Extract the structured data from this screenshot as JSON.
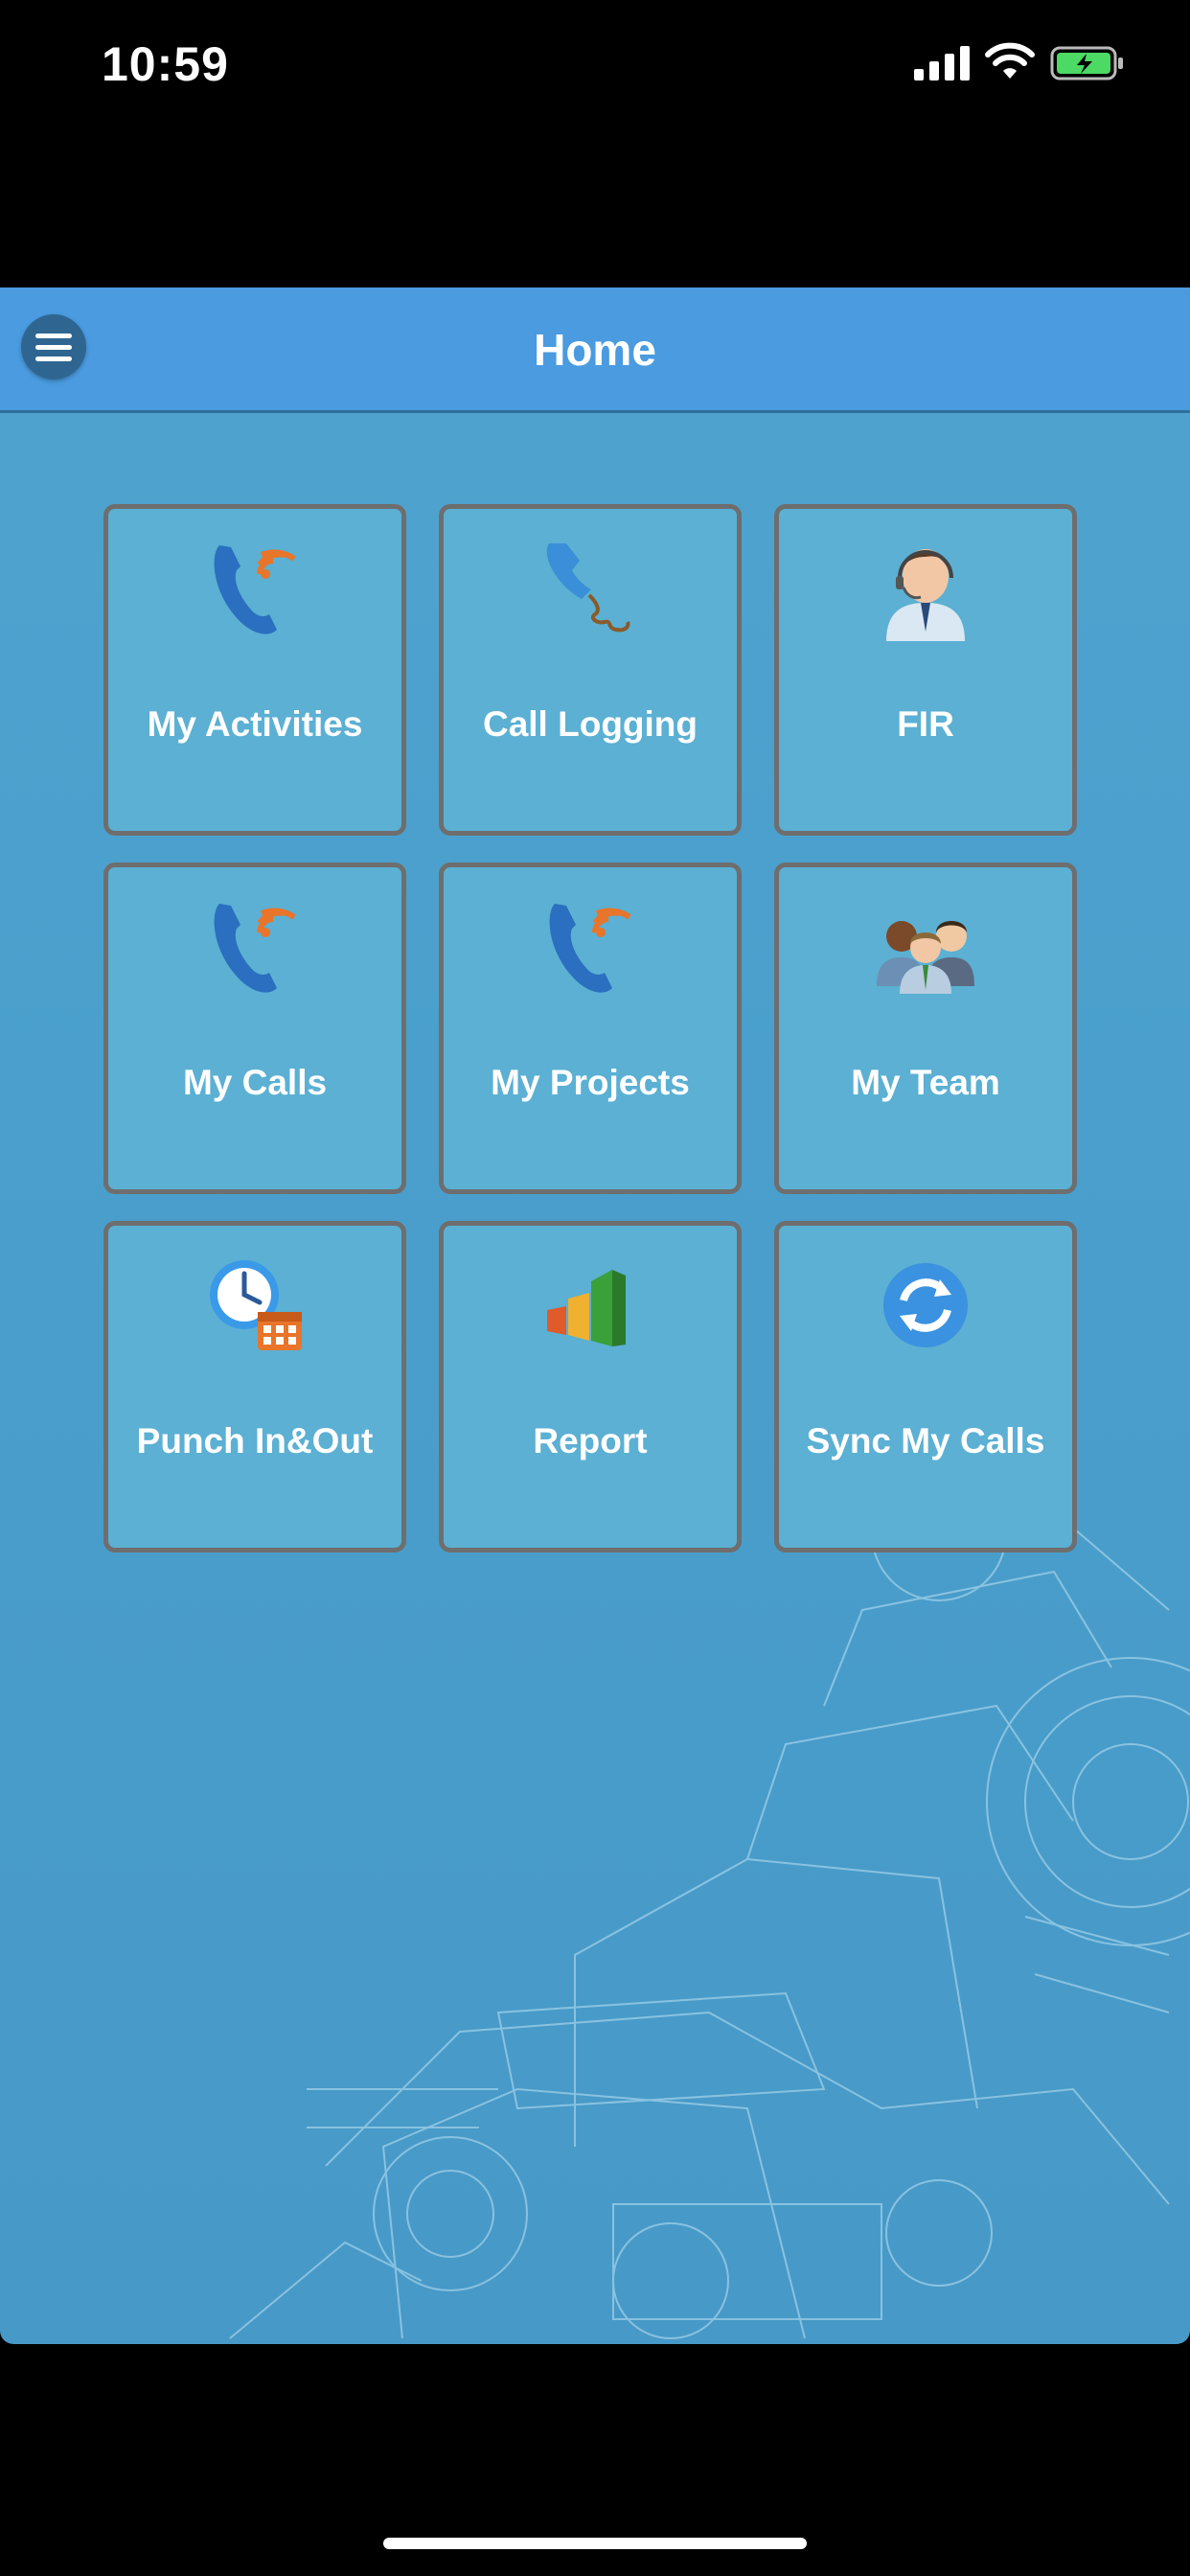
{
  "status_bar": {
    "time": "10:59"
  },
  "header": {
    "title": "Home"
  },
  "tiles": [
    {
      "label": "My Activities",
      "icon": "phone-signal-icon"
    },
    {
      "label": "Call Logging",
      "icon": "phone-handset-icon"
    },
    {
      "label": "FIR",
      "icon": "support-agent-icon"
    },
    {
      "label": "My Calls",
      "icon": "phone-signal-icon"
    },
    {
      "label": "My Projects",
      "icon": "phone-signal-icon"
    },
    {
      "label": "My Team",
      "icon": "team-icon"
    },
    {
      "label": "Punch In&Out",
      "icon": "clock-calendar-icon"
    },
    {
      "label": "Report",
      "icon": "bar-chart-icon"
    },
    {
      "label": "Sync My Calls",
      "icon": "sync-icon"
    }
  ],
  "colors": {
    "header": "#4a9be0",
    "tile": "#5bb0d3",
    "tile_border": "#6e6e6e",
    "background": "#4a9fcc"
  }
}
